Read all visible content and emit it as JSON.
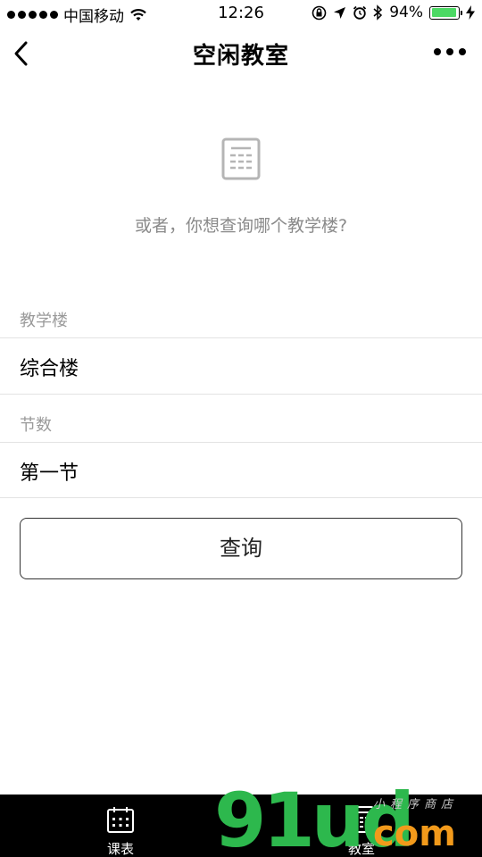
{
  "status_bar": {
    "carrier": "中国移动",
    "time": "12:26",
    "battery_percent": "94%",
    "battery_level": 0.94,
    "icons": [
      "signal-dots-icon",
      "wifi-icon",
      "orientation-lock-icon",
      "location-icon",
      "alarm-icon",
      "bluetooth-icon",
      "battery-icon",
      "charging-icon"
    ]
  },
  "nav": {
    "title": "空闲教室",
    "back_icon": "chevron-left-icon",
    "more_icon": "more-dots-icon"
  },
  "empty_state": {
    "icon": "building-icon",
    "prompt": "或者，你想查询哪个教学楼?"
  },
  "form": {
    "building_label": "教学楼",
    "building_value": "综合楼",
    "period_label": "节数",
    "period_value": "第一节",
    "query_button": "查询"
  },
  "tabbar": {
    "tabs": [
      {
        "label": "课表",
        "icon": "calendar-icon"
      },
      {
        "label": "教室",
        "icon": "classroom-icon"
      }
    ]
  },
  "watermark": {
    "logo_main": "91ud",
    "logo_suffix": "com",
    "logo_tagline": "小程序商店"
  },
  "colors": {
    "battery": "#4cd964",
    "watermark_green": "#2db84d",
    "watermark_orange": "#f29a1b"
  }
}
